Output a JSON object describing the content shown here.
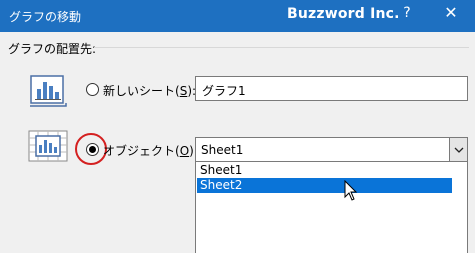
{
  "titlebar": {
    "title": "グラフの移動",
    "brand": "Buzzword Inc.",
    "help_label": "?",
    "close_label": "✕"
  },
  "placement": {
    "section_label": "グラフの配置先:",
    "new_sheet": {
      "label_prefix": "新しいシート(",
      "mnemonic": "S",
      "label_suffix": "):",
      "value": "グラフ1",
      "selected": false
    },
    "object": {
      "label_prefix": "オブジェクト(",
      "mnemonic": "O",
      "label_suffix": "):",
      "selected_value": "Sheet1",
      "selected": true,
      "options": [
        "Sheet1",
        "Sheet2"
      ],
      "highlighted_option": "Sheet2"
    }
  },
  "colors": {
    "titlebar": "#1e70c1",
    "highlight": "#0a74d8",
    "annotation_ring": "#d42020"
  }
}
